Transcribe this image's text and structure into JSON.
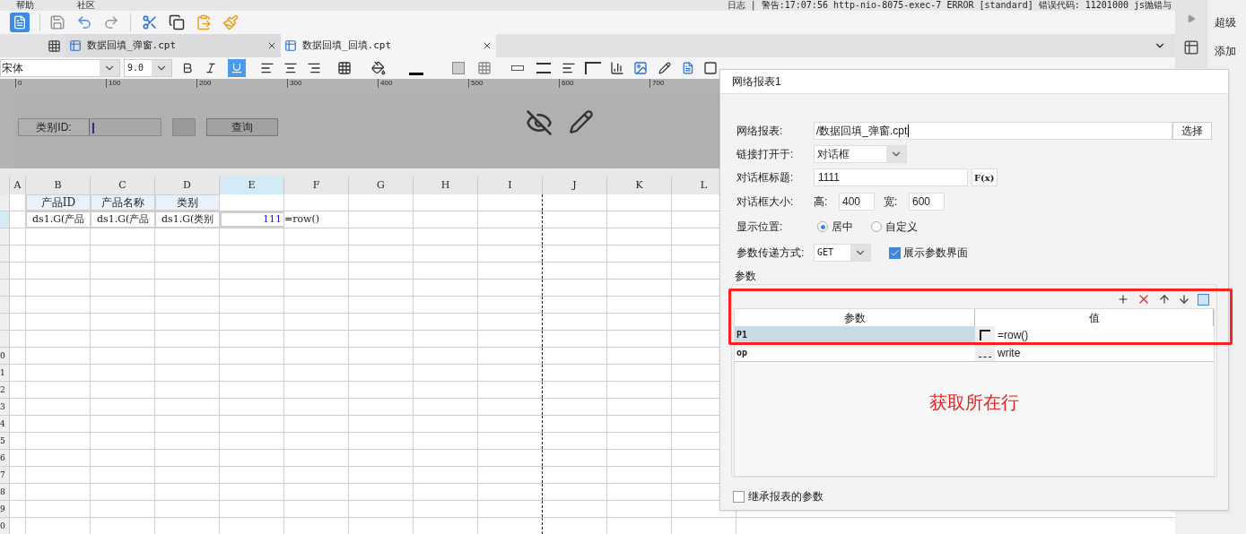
{
  "menu_bar": {
    "items": [
      "帮助",
      "社区"
    ],
    "log": "日志 | 警告:17:07:56 http-nio-8075-exec-7 ERROR [standard] 错误代码: 11201000 js抛错与"
  },
  "file_tabs": [
    {
      "label": "数据回填_弹窗.cpt",
      "selected": false
    },
    {
      "label": "数据回填_回填.cpt",
      "selected": true
    }
  ],
  "format_toolbar": {
    "font": "宋体",
    "size": "9.0",
    "underline_on": true
  },
  "ruler": {
    "ticks": [
      "0",
      "100",
      "200",
      "300",
      "400",
      "500",
      "600",
      "700"
    ]
  },
  "parameter_pane": {
    "label": "类别ID:",
    "button": "查询"
  },
  "sheet": {
    "columns": [
      {
        "label": "A",
        "selected": false
      },
      {
        "label": "B",
        "selected": false
      },
      {
        "label": "C",
        "selected": false
      },
      {
        "label": "D",
        "selected": false
      },
      {
        "label": "E",
        "selected": true
      },
      {
        "label": "F",
        "selected": false
      },
      {
        "label": "G",
        "selected": false
      },
      {
        "label": "H",
        "selected": false
      },
      {
        "label": "I",
        "selected": false
      },
      {
        "label": "J",
        "selected": false
      },
      {
        "label": "K",
        "selected": false
      },
      {
        "label": "L",
        "selected": false
      }
    ],
    "rows": [
      {
        "label": "",
        "cells": [
          "",
          "产品ID",
          "产品名称",
          "类别",
          "",
          ""
        ],
        "kind": "header"
      },
      {
        "label": "",
        "cells": [
          "",
          "ds1.G(产品",
          "ds1.G(产品",
          "ds1.G(类别",
          "111",
          "=row()"
        ],
        "kind": "data"
      },
      {
        "label": "",
        "cells": [],
        "kind": "empty"
      },
      {
        "label": "",
        "cells": [],
        "kind": "empty"
      },
      {
        "label": "",
        "cells": [],
        "kind": "empty"
      },
      {
        "label": "",
        "cells": [],
        "kind": "empty"
      },
      {
        "label": "",
        "cells": [],
        "kind": "empty"
      },
      {
        "label": "",
        "cells": [],
        "kind": "empty"
      },
      {
        "label": "",
        "cells": [],
        "kind": "empty"
      },
      {
        "label": "0",
        "cells": [],
        "kind": "empty"
      },
      {
        "label": "1",
        "cells": [],
        "kind": "empty"
      },
      {
        "label": "2",
        "cells": [],
        "kind": "empty"
      },
      {
        "label": "3",
        "cells": [],
        "kind": "empty"
      },
      {
        "label": "4",
        "cells": [],
        "kind": "empty"
      },
      {
        "label": "5",
        "cells": [],
        "kind": "empty"
      },
      {
        "label": "6",
        "cells": [],
        "kind": "empty"
      },
      {
        "label": "7",
        "cells": [],
        "kind": "empty"
      },
      {
        "label": "8",
        "cells": [],
        "kind": "empty"
      },
      {
        "label": "9",
        "cells": [],
        "kind": "empty"
      },
      {
        "label": "0",
        "cells": [],
        "kind": "empty"
      }
    ]
  },
  "dialog": {
    "title": "网络报表1",
    "report_label": "网络报表:",
    "report_value": "/数据回填_弹窗.cpt",
    "choose_button": "选择",
    "open_in_label": "链接打开于:",
    "open_in_value": "对话框",
    "dialog_title_label": "对话框标题:",
    "dialog_title_value": "1111",
    "formula_button": "F(x)",
    "size_label": "对话框大小:",
    "height_label": "高:",
    "height_value": "400",
    "width_label": "宽:",
    "width_value": "600",
    "position_label": "显示位置:",
    "positions": [
      {
        "label": "居中",
        "selected": true
      },
      {
        "label": "自定义",
        "selected": false
      }
    ],
    "method_label": "参数传递方式:",
    "method_value": "GET",
    "show_params": {
      "label": "展示参数界面",
      "checked": true
    },
    "params_section": "参数",
    "params_table": {
      "columns": [
        "参数",
        "值"
      ],
      "rows": [
        {
          "name": "P1",
          "kind": "formula",
          "value": "=row()",
          "selected": true
        },
        {
          "name": "op",
          "kind": "text",
          "value": "write",
          "selected": false
        }
      ]
    },
    "annotation": "获取所在行",
    "inherit": {
      "label": "继承报表的参数",
      "checked": false
    }
  },
  "right_panel": {
    "items": [
      "超级",
      "添加"
    ]
  }
}
